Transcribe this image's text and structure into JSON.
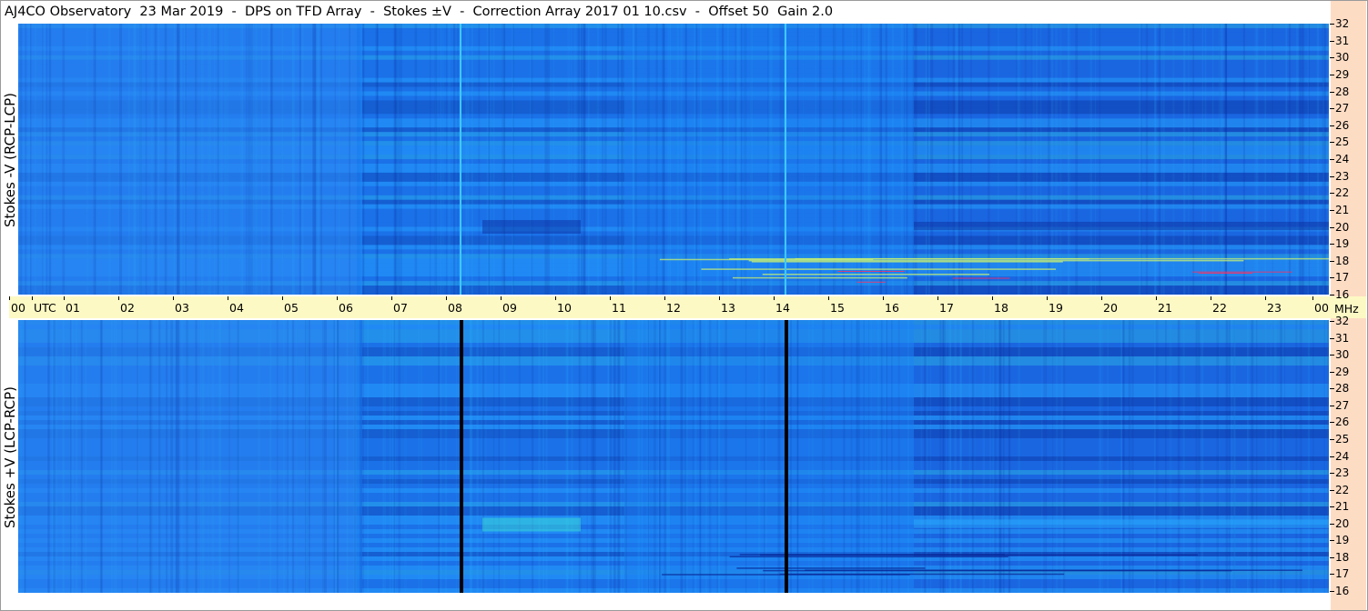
{
  "title": "AJ4CO Observatory  23 Mar 2019  -  DPS on TFD Array  -  Stokes ±V  -  Correction Array 2017 01 10.csv  -  Offset 50  Gain 2.0",
  "chart_data": [
    {
      "type": "heatmap",
      "ylabel": "Stokes -V (RCP-LCP)",
      "xlabel": "UTC",
      "xlim": [
        "00",
        "00"
      ],
      "x_ticks": [
        "00",
        "01",
        "02",
        "03",
        "04",
        "05",
        "06",
        "07",
        "08",
        "09",
        "10",
        "11",
        "12",
        "13",
        "14",
        "15",
        "16",
        "17",
        "18",
        "19",
        "20",
        "21",
        "22",
        "23",
        "00"
      ],
      "yunit": "MHz",
      "ylim": [
        16,
        32
      ],
      "y_ticks": [
        16,
        17,
        18,
        19,
        20,
        21,
        22,
        23,
        24,
        25,
        26,
        27,
        28,
        29,
        30,
        31,
        32
      ],
      "colormap": [
        "#0a2a9a",
        "#1a58d8",
        "#1c7cf0",
        "#2ab0ff",
        "#40e8d0",
        "#c8f070",
        "#ff3060"
      ],
      "vertical_lines_utc": [
        8.1,
        14.05
      ],
      "vertical_line_color": "#3ec8ff"
    },
    {
      "type": "heatmap",
      "ylabel": "Stokes +V (LCP-RCP)",
      "xlabel": "UTC",
      "xlim": [
        "00",
        "00"
      ],
      "x_ticks": [
        "00",
        "01",
        "02",
        "03",
        "04",
        "05",
        "06",
        "07",
        "08",
        "09",
        "10",
        "11",
        "12",
        "13",
        "14",
        "15",
        "16",
        "17",
        "18",
        "19",
        "20",
        "21",
        "22",
        "23",
        "00"
      ],
      "yunit": "MHz",
      "ylim": [
        16,
        32
      ],
      "y_ticks": [
        16,
        17,
        18,
        19,
        20,
        21,
        22,
        23,
        24,
        25,
        26,
        27,
        28,
        29,
        30,
        31,
        32
      ],
      "colormap": [
        "#0a2a9a",
        "#1a58d8",
        "#1c7cf0",
        "#2ab0ff",
        "#40e8d0",
        "#c8f070"
      ],
      "vertical_lines_utc": [
        8.1,
        14.05
      ],
      "vertical_line_color": "#000000"
    }
  ],
  "time_axis": {
    "unit_label": "UTC",
    "labels": [
      "00",
      "01",
      "02",
      "03",
      "04",
      "05",
      "06",
      "07",
      "08",
      "09",
      "10",
      "11",
      "12",
      "13",
      "14",
      "15",
      "16",
      "17",
      "18",
      "19",
      "20",
      "21",
      "22",
      "23",
      "00"
    ]
  },
  "freq_axis": {
    "unit_label": "MHz",
    "labels": [
      "32",
      "31",
      "30",
      "29",
      "28",
      "27",
      "26",
      "25",
      "24",
      "23",
      "22",
      "21",
      "20",
      "19",
      "18",
      "17",
      "16"
    ]
  }
}
